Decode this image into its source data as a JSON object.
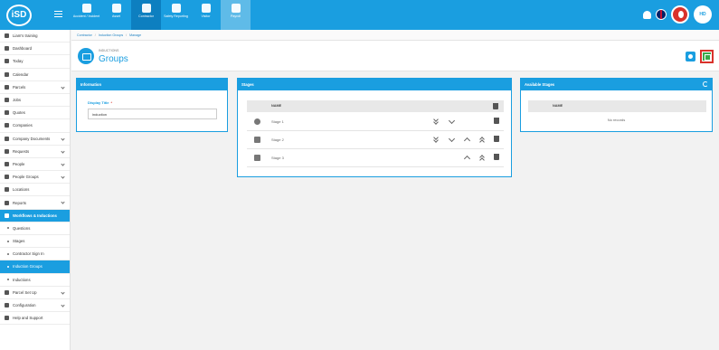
{
  "app": {
    "logo_text": "iSD",
    "avatar_initials": "HD"
  },
  "modules": [
    {
      "label": "Accident / Incident",
      "icon": "accident-icon",
      "state": "normal"
    },
    {
      "label": "Asset",
      "icon": "asset-icon",
      "state": "normal"
    },
    {
      "label": "Contractor",
      "icon": "contractor-icon",
      "state": "active"
    },
    {
      "label": "Safety Reporting",
      "icon": "safety-reporting-icon",
      "state": "normal"
    },
    {
      "label": "Visitor",
      "icon": "visitor-icon",
      "state": "normal"
    },
    {
      "label": "Payroll",
      "icon": "payroll-icon",
      "state": "dim"
    }
  ],
  "sidebar": {
    "items": [
      {
        "label": "Liam's training",
        "icon": "training-icon",
        "type": "top"
      },
      {
        "label": "Dashboard",
        "icon": "dashboard-icon"
      },
      {
        "label": "Today",
        "icon": "today-icon"
      },
      {
        "label": "Calendar",
        "icon": "calendar-icon"
      },
      {
        "label": "Parcels",
        "icon": "parcels-icon",
        "chevron": true
      },
      {
        "label": "Jobs",
        "icon": "jobs-icon"
      },
      {
        "label": "Quotes",
        "icon": "quotes-icon"
      },
      {
        "label": "Companies",
        "icon": "companies-icon"
      },
      {
        "label": "Company Documents",
        "icon": "documents-icon",
        "chevron": true
      },
      {
        "label": "Requests",
        "icon": "requests-icon",
        "chevron": true
      },
      {
        "label": "People",
        "icon": "people-icon",
        "chevron": true
      },
      {
        "label": "People Groups",
        "icon": "people-groups-icon",
        "chevron": true
      },
      {
        "label": "Locations",
        "icon": "locations-icon"
      },
      {
        "label": "Reports",
        "icon": "reports-icon",
        "chevron": true
      },
      {
        "label": "Workflows & Inductions",
        "icon": "workflows-icon",
        "type": "hdr"
      },
      {
        "label": "Questions",
        "type": "sub"
      },
      {
        "label": "Stages",
        "type": "sub"
      },
      {
        "label": "Contractor Sign In",
        "type": "sub"
      },
      {
        "label": "Induction Groups",
        "type": "sub",
        "selected": true
      },
      {
        "label": "Inductions",
        "type": "sub"
      },
      {
        "label": "Parcel Set Up",
        "icon": "parcel-setup-icon",
        "chevron": true
      },
      {
        "label": "Configuration",
        "icon": "configuration-icon",
        "chevron": true
      },
      {
        "label": "Help and Support",
        "icon": "help-icon"
      }
    ]
  },
  "breadcrumb": [
    "Contractor",
    "Induction Groups",
    "Manage"
  ],
  "header": {
    "overline": "INDUCTIONS",
    "title": "Groups"
  },
  "information": {
    "title": "Information",
    "field_label": "Display Title",
    "field_required": "*",
    "field_value": "induction"
  },
  "stages": {
    "title": "Stages",
    "column_name": "NAME",
    "rows": [
      {
        "label": "Stage 1",
        "icon": "check-icon",
        "controls": [
          "dd",
          "d",
          "tr"
        ]
      },
      {
        "label": "Stage 2",
        "icon": "stage-icon",
        "controls": [
          "dd",
          "d",
          "u",
          "uu",
          "tr"
        ]
      },
      {
        "label": "Stage 3",
        "icon": "stage-icon",
        "controls": [
          "u",
          "uu",
          "tr"
        ]
      }
    ]
  },
  "available": {
    "title": "Available Stages",
    "column_name": "NAME",
    "empty_text": "No records"
  },
  "colors": {
    "brand": "#1a9ee0",
    "active_module": "#0d7fc0",
    "save": "#3aa94b",
    "highlight_border": "#d9322b"
  }
}
